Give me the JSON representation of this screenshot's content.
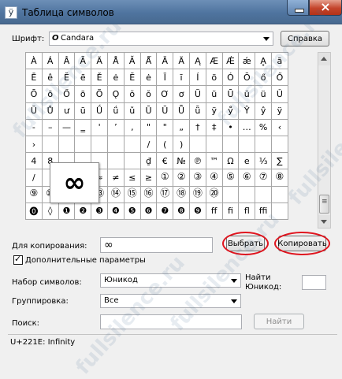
{
  "window": {
    "title": "Таблица символов"
  },
  "font_row": {
    "label": "Шрифт:",
    "font_glyph": "O",
    "value": "Candara",
    "help_button": "Справка"
  },
  "grid": {
    "rows": [
      [
        "À",
        "Á",
        "Â",
        "Ã",
        "Ä",
        "Å",
        "Ă",
        "Ǻ",
        "Ā",
        "Ä",
        "Ą",
        "Æ",
        "Ǽ",
        "ǽ",
        "Ḁ",
        "ã"
      ],
      [
        "Ē",
        "ê",
        "Ĕ",
        "ẽ",
        "Ě",
        "ė",
        "Ĕ",
        "ė",
        "Ī",
        "ī",
        "Í",
        "ö",
        "Ó",
        "Ō",
        "ő",
        "Ő"
      ],
      [
        "Ō",
        "ō",
        "Ő",
        "õ",
        "Õ",
        "Ǫ",
        "ŏ",
        "ŏ",
        "Ơ",
        "ơ",
        "Ũ",
        "ũ",
        "Ū",
        "ū",
        "ü",
        "Ǔ"
      ],
      [
        "Ŭ",
        "Ů",
        "ư",
        "ū",
        "Ǘ",
        "ǘ",
        "ǔ",
        "Ū",
        "Ū",
        "Ǖ",
        "ǖ",
        "ÿ",
        "ẙ",
        "Ŷ",
        "ŷ",
        "ÿ"
      ],
      [
        "-",
        "–",
        "—",
        "‗",
        "'",
        "ʼ",
        "‚",
        "\"",
        "\"",
        "„",
        "†",
        "‡",
        "•",
        "…",
        "%",
        "‹"
      ],
      [
        "›",
        "",
        "",
        "",
        "",
        "",
        "",
        "/",
        "(",
        ")",
        "",
        "",
        "",
        "",
        "",
        ""
      ],
      [
        "4",
        "8",
        "",
        "",
        "",
        "",
        "",
        "₫",
        "€",
        "№",
        "℗",
        "™",
        "Ω",
        "e",
        "⅓",
        "∑"
      ],
      [
        "/",
        "",
        "",
        "",
        "≈",
        "≠",
        "≤",
        "≥",
        "①",
        "②",
        "③",
        "④",
        "⑤",
        "⑥",
        "⑦",
        "⑧"
      ],
      [
        "⑨",
        "⑩",
        "⑪",
        "⑫",
        "⑬",
        "⑭",
        "⑮",
        "⑯",
        "⑰",
        "⑱",
        "⑲",
        "⑳",
        "",
        "",
        "",
        ""
      ],
      [
        "⓿",
        "◊",
        "❶",
        "❷",
        "❸",
        "❹",
        "❺",
        "❻",
        "❼",
        "❽",
        "❾",
        "ff",
        "fi",
        "fl",
        "ffi",
        ""
      ]
    ],
    "dark_from_row": 8,
    "zoom_glyph": "∞"
  },
  "copy_row": {
    "label": "Для копирования:",
    "value": "∞",
    "select_button": "Выбрать",
    "copy_button": "Копировать"
  },
  "advanced": {
    "label": "Дополнительные параметры",
    "checked": true
  },
  "charset": {
    "label": "Набор символов:",
    "value": "Юникод"
  },
  "find_unicode": {
    "label_line1": "Найти",
    "label_line2": "Юникод:",
    "value": ""
  },
  "grouping": {
    "label": "Группировка:",
    "value": "Все"
  },
  "search": {
    "label": "Поиск:",
    "value": "",
    "button": "Найти"
  },
  "status": {
    "text": "U+221E: Infinity"
  },
  "watermark": {
    "text": "fullsilence.ru"
  },
  "colors": {
    "accent_circle": "#e0141e",
    "titlebar": "#4f749f"
  }
}
